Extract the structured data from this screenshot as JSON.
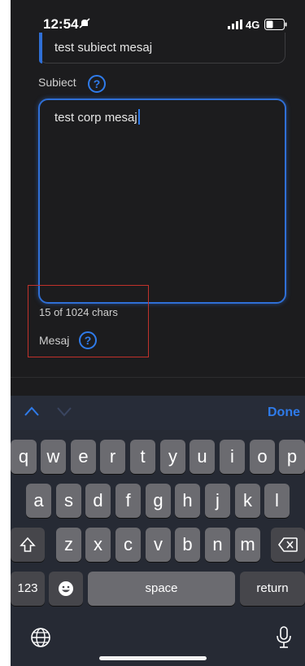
{
  "status_bar": {
    "time": "12:54",
    "network": "4G"
  },
  "subject": {
    "value": "test subiect mesaj",
    "label": "Subiect",
    "help": "?"
  },
  "body": {
    "value": "test corp mesaj",
    "char_count": "15 of 1024 chars",
    "label": "Mesaj",
    "help": "?"
  },
  "keyboard": {
    "done_label": "Done",
    "row1": [
      "q",
      "w",
      "e",
      "r",
      "t",
      "y",
      "u",
      "i",
      "o",
      "p"
    ],
    "row2": [
      "a",
      "s",
      "d",
      "f",
      "g",
      "h",
      "j",
      "k",
      "l"
    ],
    "row3": [
      "z",
      "x",
      "c",
      "v",
      "b",
      "n",
      "m"
    ],
    "numbers_label": "123",
    "space_label": "space",
    "return_label": "return"
  },
  "colors": {
    "accent": "#2f7bea",
    "highlight": "#c0322b",
    "background": "#1c1c1e"
  }
}
